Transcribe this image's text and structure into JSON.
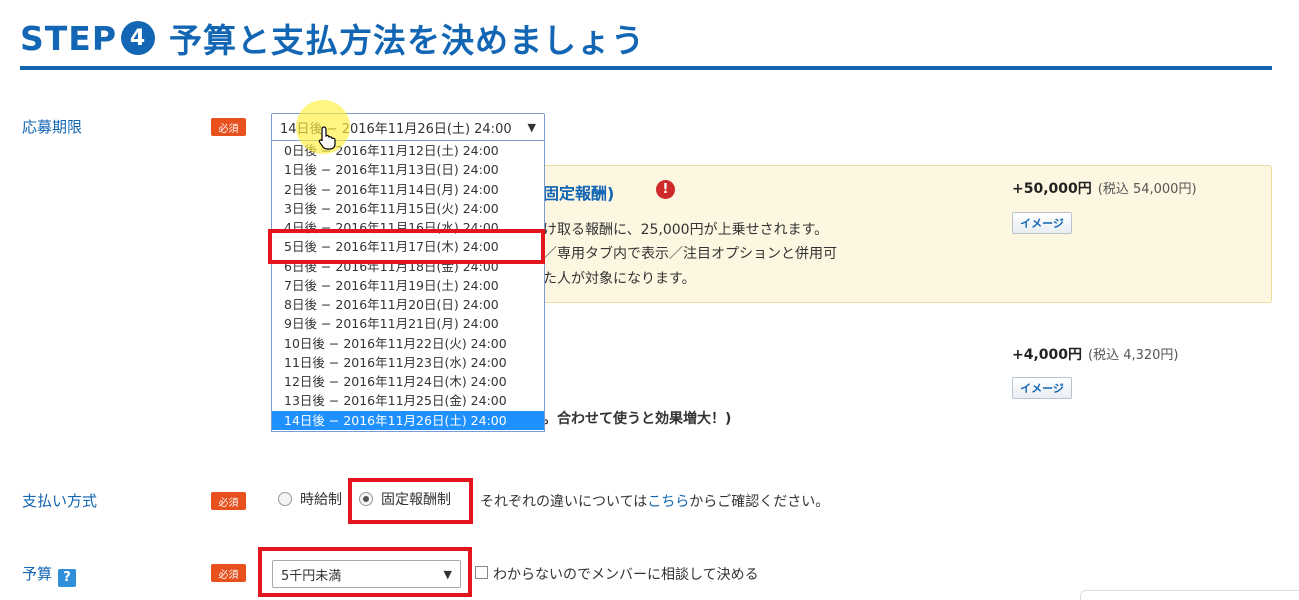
{
  "header": {
    "step_label": "STEP",
    "step_number": "4",
    "title": "予算と支払方法を決めましょう",
    "accent_color": "#1266b3"
  },
  "deadline": {
    "label": "応募期限",
    "required_badge": "必須",
    "selected": "14日後 − 2016年11月26日(土) 24:00",
    "options": [
      "0日後 − 2016年11月12日(土) 24:00",
      "1日後 − 2016年11月13日(日) 24:00",
      "2日後 − 2016年11月14日(月) 24:00",
      "3日後 − 2016年11月15日(火) 24:00",
      "4日後 − 2016年11月16日(水) 24:00",
      "5日後 − 2016年11月17日(木) 24:00",
      "6日後 − 2016年11月18日(金) 24:00",
      "7日後 − 2016年11月19日(土) 24:00",
      "8日後 − 2016年11月20日(日) 24:00",
      "9日後 − 2016年11月21日(月) 24:00",
      "10日後 − 2016年11月22日(火) 24:00",
      "11日後 − 2016年11月23日(水) 24:00",
      "12日後 − 2016年11月24日(木) 24:00",
      "13日後 − 2016年11月25日(金) 24:00",
      "14日後 − 2016年11月26日(土) 24:00"
    ]
  },
  "premium_option": {
    "title": "固定報酬)",
    "line1": "け取る報酬に、25,000円が上乗せされます。",
    "line2": "／専用タブ内で表示／注目オプションと併用可",
    "line3": "た人が対象になります。",
    "price": "+50,000円",
    "price_tax": "(税込 54,000円)",
    "image_button": "イメージ"
  },
  "second_option": {
    "price": "+4,000円",
    "price_tax": "(税込 4,320円)",
    "image_button": "イメージ",
    "note": "。合わせて使うと効果増大！)"
  },
  "payment": {
    "label": "支払い方式",
    "required_badge": "必須",
    "option_hourly": "時給制",
    "option_fixed": "固定報酬制",
    "selected": "固定報酬制",
    "note_prefix": "それぞれの違いについては",
    "note_link": "こちら",
    "note_suffix": "からご確認ください。"
  },
  "budget": {
    "label": "予算",
    "help_icon": "?",
    "required_badge": "必須",
    "selected": "5千円未満",
    "checkbox_label": "わからないのでメンバーに相談して決める",
    "checkbox_checked": false
  },
  "icons": {
    "dropdown_arrow": "▼",
    "warning": "!"
  }
}
